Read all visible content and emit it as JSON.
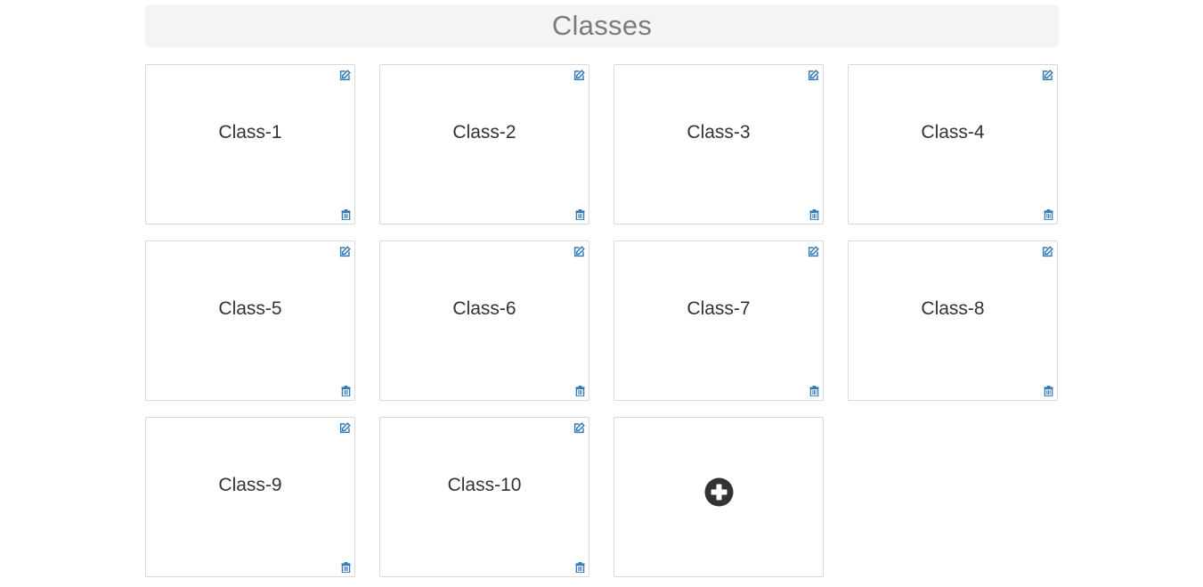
{
  "header": {
    "title": "Classes"
  },
  "classes": [
    {
      "label": "Class-1"
    },
    {
      "label": "Class-2"
    },
    {
      "label": "Class-3"
    },
    {
      "label": "Class-4"
    },
    {
      "label": "Class-5"
    },
    {
      "label": "Class-6"
    },
    {
      "label": "Class-7"
    },
    {
      "label": "Class-8"
    },
    {
      "label": "Class-9"
    },
    {
      "label": "Class-10"
    }
  ],
  "icons": {
    "edit": "edit-icon",
    "delete": "trash-icon",
    "add": "plus-circle-icon"
  },
  "colors": {
    "icon_blue": "#337ab7",
    "add_dark": "#333333",
    "header_bg": "#f4f4f4",
    "header_text": "#7b7b7b"
  }
}
